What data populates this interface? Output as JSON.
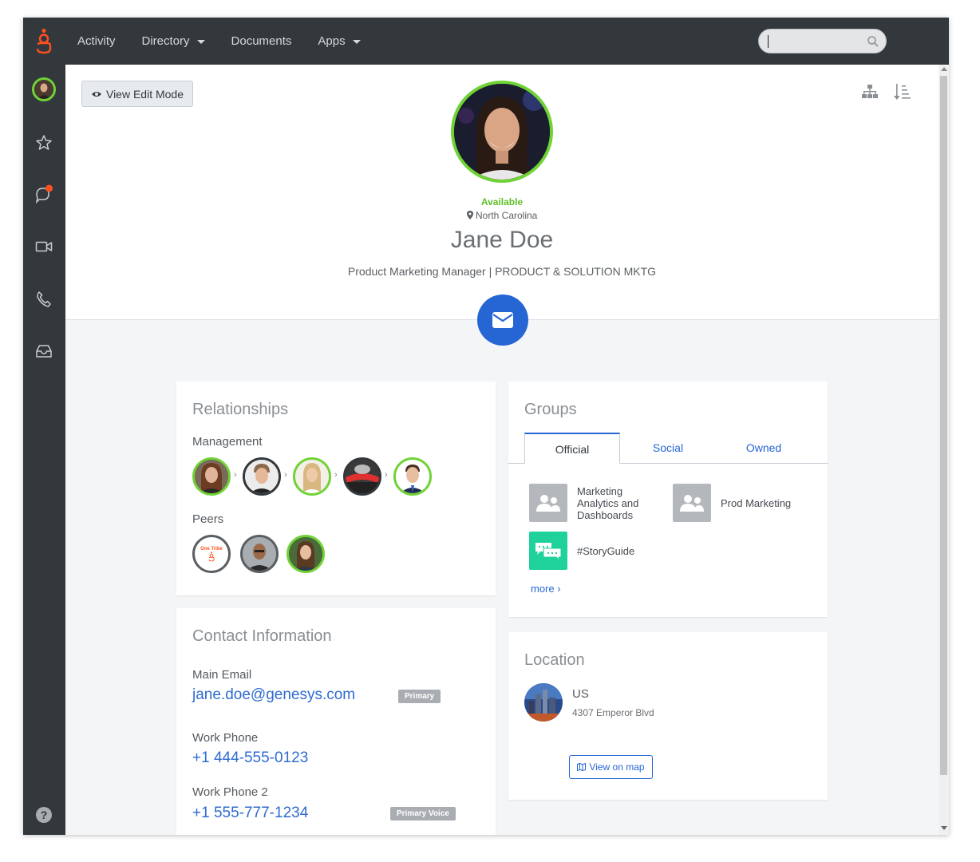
{
  "nav": {
    "items": [
      {
        "label": "Activity",
        "has_dropdown": false
      },
      {
        "label": "Directory",
        "has_dropdown": true
      },
      {
        "label": "Documents",
        "has_dropdown": false
      },
      {
        "label": "Apps",
        "has_dropdown": true
      }
    ],
    "search": {
      "value": "",
      "placeholder": ""
    }
  },
  "sidebar": {
    "items": [
      "avatar",
      "star-icon",
      "chat-icon",
      "video-icon",
      "phone-icon",
      "inbox-icon"
    ],
    "help_label": "?"
  },
  "profile": {
    "edit_button_label": "View Edit Mode",
    "status": "Available",
    "location": "North Carolina",
    "name": "Jane Doe",
    "title": "Product Marketing Manager | PRODUCT & SOLUTION MKTG"
  },
  "relationships": {
    "title": "Relationships",
    "management_label": "Management",
    "peers_label": "Peers",
    "peer_badge_text": "One Tribe"
  },
  "groups": {
    "title": "Groups",
    "tabs": [
      "Official",
      "Social",
      "Owned"
    ],
    "active_tab": "Official",
    "items": [
      {
        "label": "Marketing Analytics and Dashboards"
      },
      {
        "label": "Prod Marketing"
      },
      {
        "label": "#StoryGuide"
      }
    ],
    "more_label": "more ›"
  },
  "contact": {
    "title": "Contact Information",
    "fields": [
      {
        "label": "Main Email",
        "value": "jane.doe@genesys.com",
        "badge": "Primary"
      },
      {
        "label": "Work Phone",
        "value": "+1 444-555-0123",
        "badge": ""
      },
      {
        "label": "Work Phone 2",
        "value": "+1 555-777-1234",
        "badge": "Primary Voice"
      }
    ]
  },
  "location": {
    "title": "Location",
    "country": "US",
    "address": "4307 Emperor Blvd",
    "map_button_label": "View on map"
  },
  "colors": {
    "accent": "#2566d4",
    "available": "#6fd336",
    "topbar": "#33383d",
    "brand": "#ff4f1f"
  }
}
